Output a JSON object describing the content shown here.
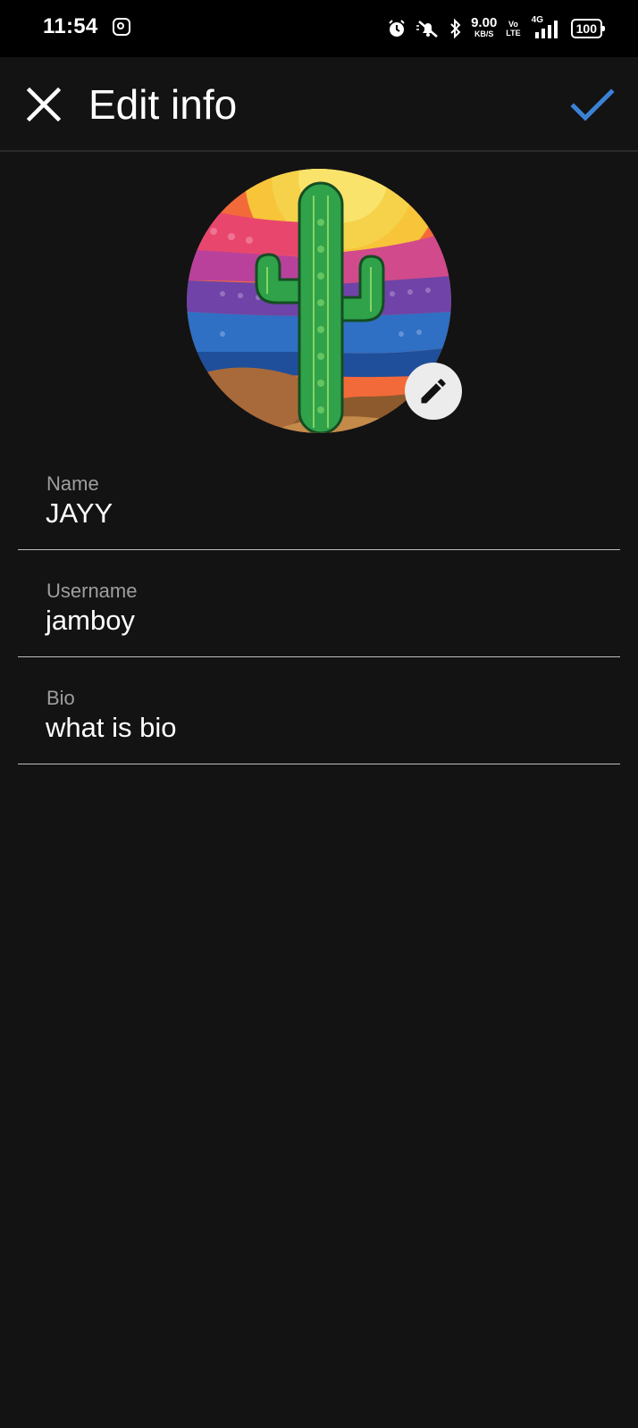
{
  "status_bar": {
    "time": "11:54",
    "speed_value": "9.00",
    "speed_unit": "KB/S",
    "volte_top": "Vo",
    "volte_bottom": "LTE",
    "network": "4G",
    "battery": "100",
    "icons": [
      "instagram-icon",
      "alarm-icon",
      "mute-icon",
      "bluetooth-icon",
      "signal-icon",
      "battery-icon"
    ]
  },
  "header": {
    "title": "Edit info",
    "close_icon": "close-icon",
    "save_icon": "check-icon",
    "accent_color": "#3b82d6"
  },
  "profile": {
    "avatar_icon": "cactus-avatar",
    "edit_icon": "pencil-icon"
  },
  "fields": [
    {
      "label": "Name",
      "value": "JAYY"
    },
    {
      "label": "Username",
      "value": "jamboy"
    },
    {
      "label": "Bio",
      "value": "what is bio"
    }
  ]
}
